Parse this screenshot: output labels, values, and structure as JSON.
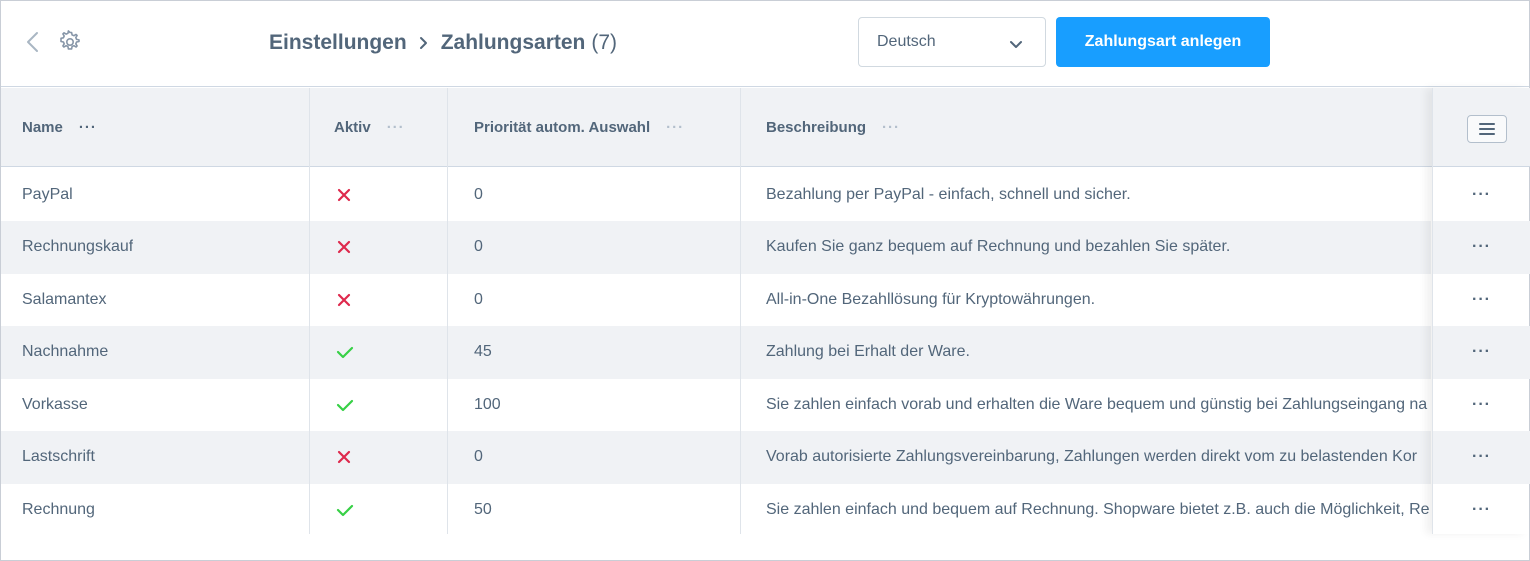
{
  "header": {
    "breadcrumb": [
      "Einstellungen",
      "Zahlungsarten"
    ],
    "count": "(7)",
    "language": "Deutsch",
    "create_button": "Zahlungsart anlegen"
  },
  "columns": {
    "name": "Name",
    "active": "Aktiv",
    "priority": "Priorität autom. Auswahl",
    "description": "Beschreibung",
    "menu_dots": "···"
  },
  "colors": {
    "primary": "#189eff",
    "active_true": "#37d046",
    "active_false": "#de294c",
    "text": "#52667a",
    "stripe": "#f0f2f5"
  },
  "rows": [
    {
      "name": "PayPal",
      "active": false,
      "priority": "0",
      "description": "Bezahlung per PayPal - einfach, schnell und sicher."
    },
    {
      "name": "Rechnungskauf",
      "active": false,
      "priority": "0",
      "description": "Kaufen Sie ganz bequem auf Rechnung und bezahlen Sie später."
    },
    {
      "name": "Salamantex",
      "active": false,
      "priority": "0",
      "description": "All-in-One Bezahllösung für Kryptowährungen."
    },
    {
      "name": "Nachnahme",
      "active": true,
      "priority": "45",
      "description": "Zahlung bei Erhalt der Ware."
    },
    {
      "name": "Vorkasse",
      "active": true,
      "priority": "100",
      "description": "Sie zahlen einfach vorab und erhalten die Ware bequem und günstig bei Zahlungseingang na"
    },
    {
      "name": "Lastschrift",
      "active": false,
      "priority": "0",
      "description": "Vorab autorisierte Zahlungsvereinbarung, Zahlungen werden direkt vom zu belastenden Kor"
    },
    {
      "name": "Rechnung",
      "active": true,
      "priority": "50",
      "description": "Sie zahlen einfach und bequem auf Rechnung. Shopware bietet z.B. auch die Möglichkeit, Re"
    }
  ],
  "row_action_label": "···"
}
